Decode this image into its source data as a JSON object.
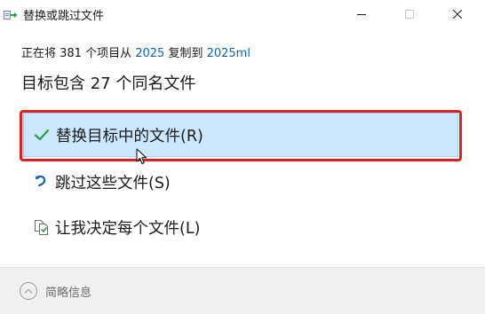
{
  "window": {
    "title": "替换或跳过文件",
    "controls": {
      "minimize_icon": "minimize-icon",
      "maximize_icon": "maximize-icon",
      "close_icon": "close-icon"
    }
  },
  "summary": {
    "prefix": "正在将 381 个项目从 ",
    "source": "2025",
    "middle": " 复制到 ",
    "destination": "2025ml"
  },
  "heading": "目标包含 27 个同名文件",
  "options": [
    {
      "label": "替换目标中的文件(R)",
      "icon": "checkmark-icon",
      "selected": true
    },
    {
      "label": "跳过这些文件(S)",
      "icon": "skip-arrow-icon",
      "selected": false
    },
    {
      "label": "让我决定每个文件(L)",
      "icon": "compare-files-icon",
      "selected": false
    }
  ],
  "footer": {
    "details_label": "简略信息",
    "details_icon": "chevron-up-icon"
  },
  "colors": {
    "link": "#0f63b6",
    "selection_bg": "#cce8ff",
    "selection_border": "#99d1ff",
    "annotation_red": "#e02020",
    "check_green": "#2a9d4a"
  }
}
